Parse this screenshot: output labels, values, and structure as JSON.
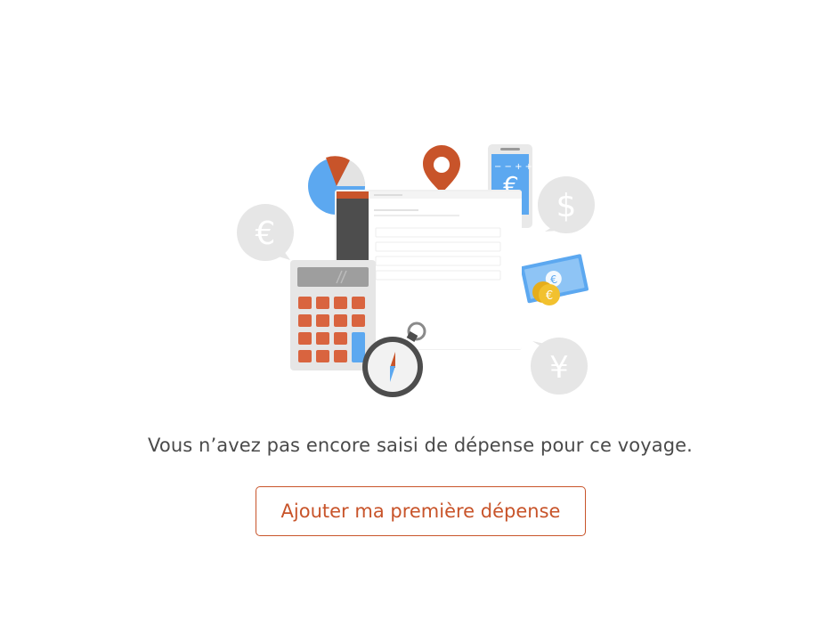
{
  "empty_state": {
    "message": "Vous n’avez pas encore saisi de dépense pour ce voyage.",
    "add_button_label": "Ajouter ma première dépense"
  },
  "illustration": {
    "bubble_symbols": {
      "euro": "€",
      "dollar": "$",
      "yen": "¥"
    },
    "phone_currency": "€",
    "banknote_symbol": "€",
    "coin_symbol": "€"
  },
  "colors": {
    "accent": "#c8542a",
    "text": "#4a4a4a",
    "blue": "#5ca8f0",
    "light_gray": "#e3e3e3",
    "dark_gray": "#4d4d4d",
    "gold": "#f2c12e"
  }
}
